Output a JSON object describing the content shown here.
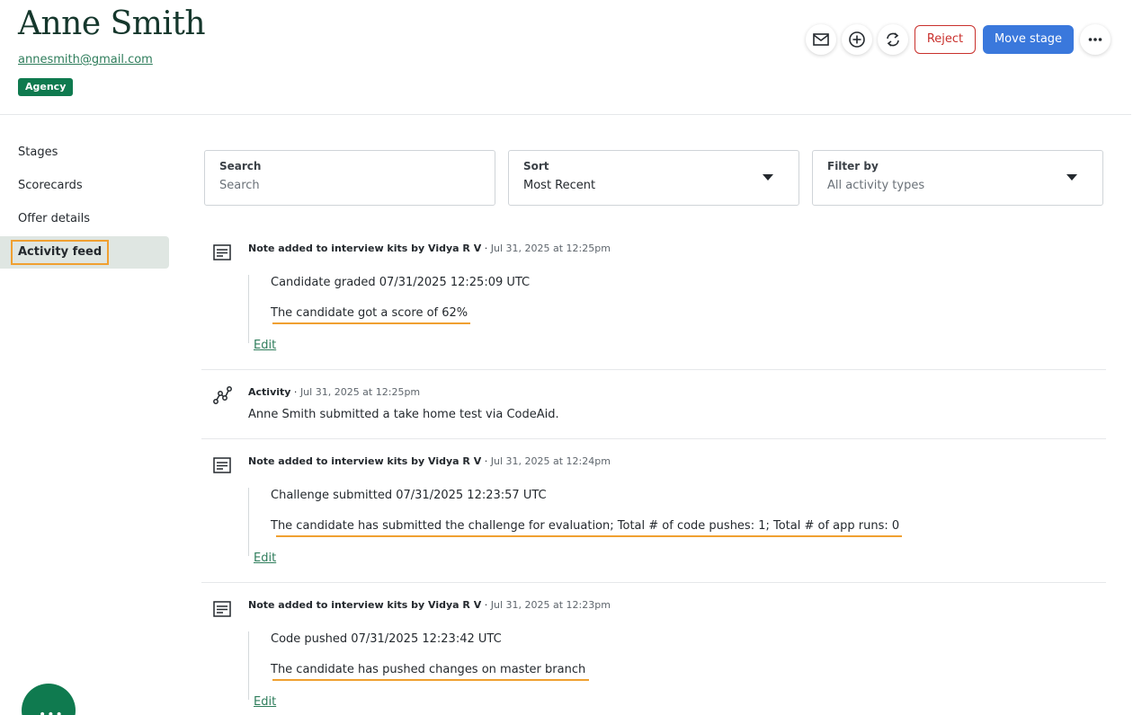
{
  "candidate": {
    "name": "Anne Smith",
    "email": "annesmith@gmail.com",
    "badge": "Agency"
  },
  "actions": {
    "reject_label": "Reject",
    "move_stage_label": "Move stage",
    "icons": [
      "mail-icon",
      "add-icon",
      "sync-icon",
      "more-icon"
    ]
  },
  "sidebar": {
    "items": [
      {
        "label": "Stages"
      },
      {
        "label": "Scorecards"
      },
      {
        "label": "Offer details"
      },
      {
        "label": "Activity feed",
        "active": true
      }
    ]
  },
  "filters": {
    "search": {
      "label": "Search",
      "placeholder": "Search"
    },
    "sort": {
      "label": "Sort",
      "value": "Most Recent"
    },
    "filter": {
      "label": "Filter by",
      "value": "All activity types"
    }
  },
  "feed": [
    {
      "title": "Note added to interview kits by Vidya R V",
      "time": "Jul 31, 2025 at 12:25pm",
      "line1": "Candidate graded 07/31/2025 12:25:09 UTC",
      "line2": "The candidate got a score of 62%",
      "edit": "Edit"
    },
    {
      "title": "Activity",
      "time": "Jul 31, 2025 at 12:25pm",
      "text": "Anne Smith submitted a take home test via CodeAid."
    },
    {
      "title": "Note added to interview kits by Vidya R V",
      "time": "Jul 31, 2025 at 12:24pm",
      "line1": "Challenge submitted 07/31/2025 12:23:57 UTC",
      "line2": "The candidate has submitted the challenge for evaluation; Total # of code pushes: 1; Total # of app runs: 0",
      "edit": "Edit"
    },
    {
      "title": "Note added to interview kits by Vidya R V",
      "time": "Jul 31, 2025 at 12:23pm",
      "line1": "Code pushed 07/31/2025 12:23:42 UTC",
      "line2": "The candidate has pushed changes on master branch",
      "edit": "Edit"
    }
  ],
  "colors": {
    "brand_green": "#0f7a4f",
    "primary_blue": "#3a78dc",
    "reject_red": "#c9302c",
    "highlight_orange": "#f0a030"
  }
}
